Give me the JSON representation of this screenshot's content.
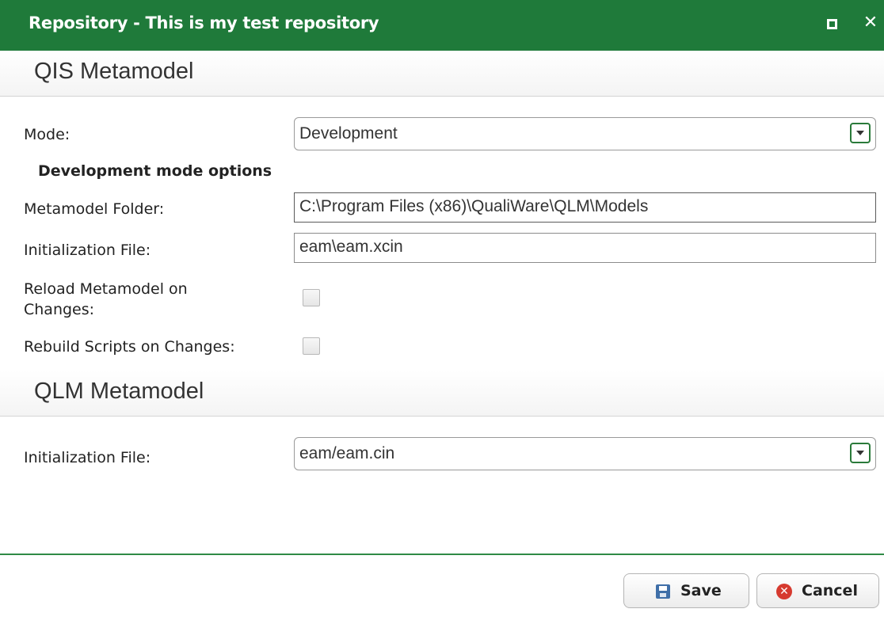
{
  "window": {
    "title": "Repository - This is my test repository",
    "maximize_icon": "maximize-icon",
    "close_icon": "close-icon",
    "close_glyph": "✕"
  },
  "qis_section": {
    "title": "QIS Metamodel",
    "mode_label": "Mode:",
    "mode_value": "Development",
    "dev_heading": "Development mode options",
    "metamodel_folder_label": "Metamodel Folder:",
    "metamodel_folder_value": "C:\\Program Files (x86)\\QualiWare\\QLM\\Models",
    "init_file_label": "Initialization File:",
    "init_file_value": "eam\\eam.xcin",
    "reload_label_line1": "Reload Metamodel on",
    "reload_label_line2": "Changes:",
    "rebuild_label": "Rebuild Scripts on Changes:"
  },
  "qlm_section": {
    "title": "QLM Metamodel",
    "init_file_label": "Initialization File:",
    "init_file_value": "eam/eam.cin"
  },
  "buttons": {
    "save_label": "Save",
    "cancel_label": "Cancel",
    "cancel_glyph": "✕"
  },
  "colors": {
    "titlebar": "#1f7a3a",
    "accent_line": "#2f8a45"
  }
}
